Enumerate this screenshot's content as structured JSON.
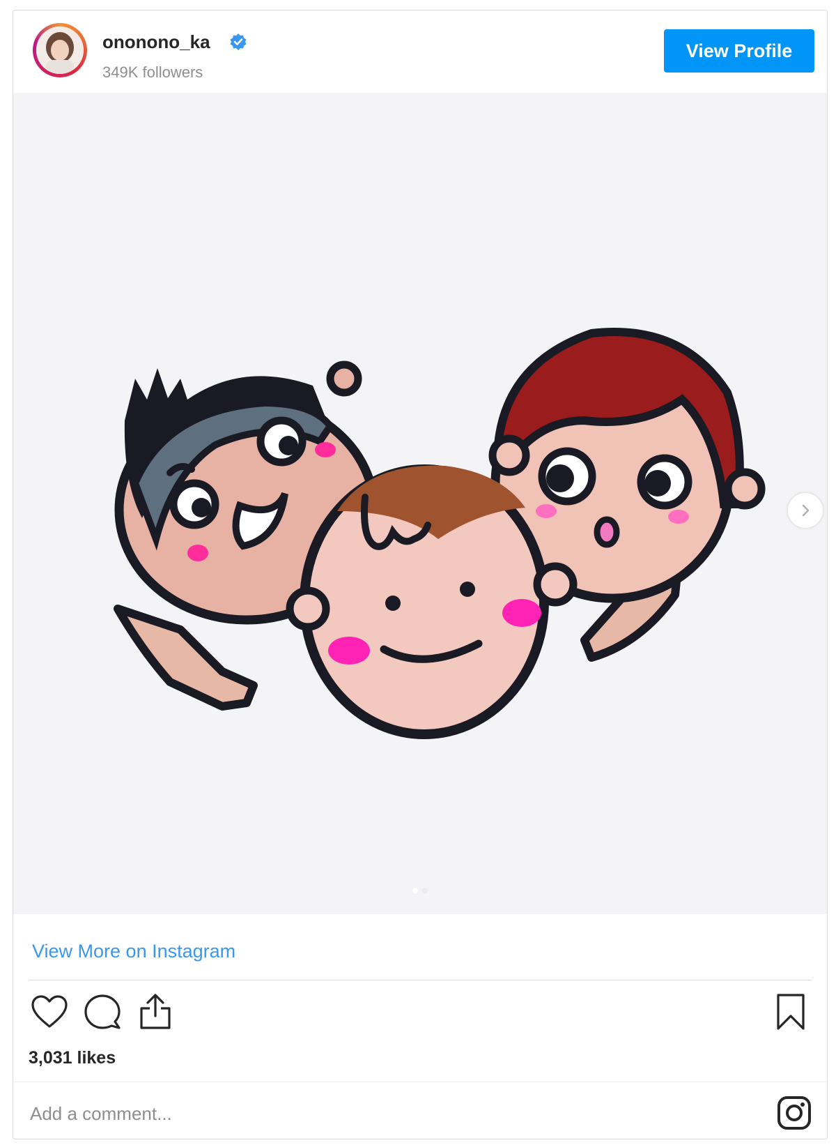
{
  "header": {
    "username": "ononono_ka",
    "followers": "349K followers",
    "view_profile_label": "View Profile"
  },
  "post": {
    "carousel_position": {
      "current": 1,
      "total": 2
    }
  },
  "footer": {
    "view_more_label": "View More on Instagram",
    "likes": "3,031 likes",
    "comment_placeholder": "Add a comment..."
  },
  "colors": {
    "accent": "#0095f6",
    "link": "#3897f0",
    "text": "#262626",
    "muted": "#8e8e8e"
  },
  "icons": [
    "verified-badge-icon",
    "heart-icon",
    "comment-icon",
    "share-icon",
    "bookmark-icon",
    "instagram-logo-icon",
    "chevron-right-icon"
  ]
}
